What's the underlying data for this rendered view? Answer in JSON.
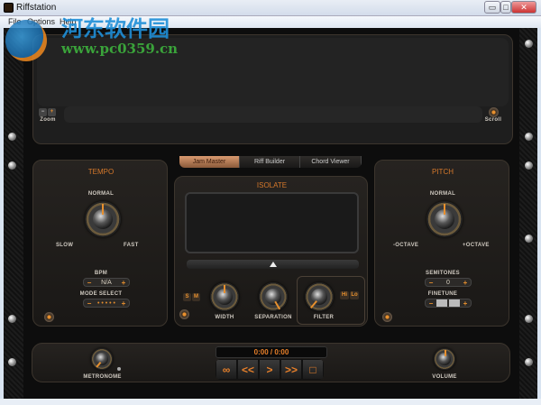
{
  "window": {
    "title": "Riffstation",
    "minimize": "▭",
    "maximize": "□",
    "close": "✕"
  },
  "menu": [
    "File",
    "Options",
    "Help"
  ],
  "watermark": {
    "line1": "河东软件园",
    "line2": "www.pc0359.cn"
  },
  "waveform": {
    "zoom_label": "Zoom",
    "zoom_minus": "−",
    "zoom_plus": "+",
    "scroll_label": "Scroll"
  },
  "tabs": [
    {
      "label": "Jam Master",
      "active": true
    },
    {
      "label": "Riff Builder"
    },
    {
      "label": "Chord Viewer"
    }
  ],
  "tempo": {
    "title": "TEMPO",
    "normal": "NORMAL",
    "slow": "SLOW",
    "fast": "FAST",
    "bpm_label": "BPM",
    "bpm_value": "N/A",
    "mode_label": "MODE SELECT",
    "mode_value": "• • • • •",
    "minus": "−",
    "plus": "+"
  },
  "isolate": {
    "title": "ISOLATE",
    "s": "S",
    "m": "M",
    "width": "WIDTH",
    "separation": "SEPARATION",
    "filter": "FILTER",
    "hi": "Hi",
    "lo": "Lo"
  },
  "pitch": {
    "title": "PITCH",
    "normal": "NORMAL",
    "minus_octave": "-OCTAVE",
    "plus_octave": "+OCTAVE",
    "semitones_label": "SEMITONES",
    "semitones_value": "0",
    "finetune_label": "FINETUNE",
    "minus": "−",
    "plus": "+"
  },
  "transport": {
    "time": "0:00 / 0:00",
    "loop": "∞",
    "rewind": "<<",
    "play": ">",
    "forward": ">>",
    "stop": "□",
    "metronome": "METRONOME",
    "volume": "VOLUME"
  },
  "colors": {
    "accent": "#e8802a",
    "background": "#0d0d0d"
  }
}
